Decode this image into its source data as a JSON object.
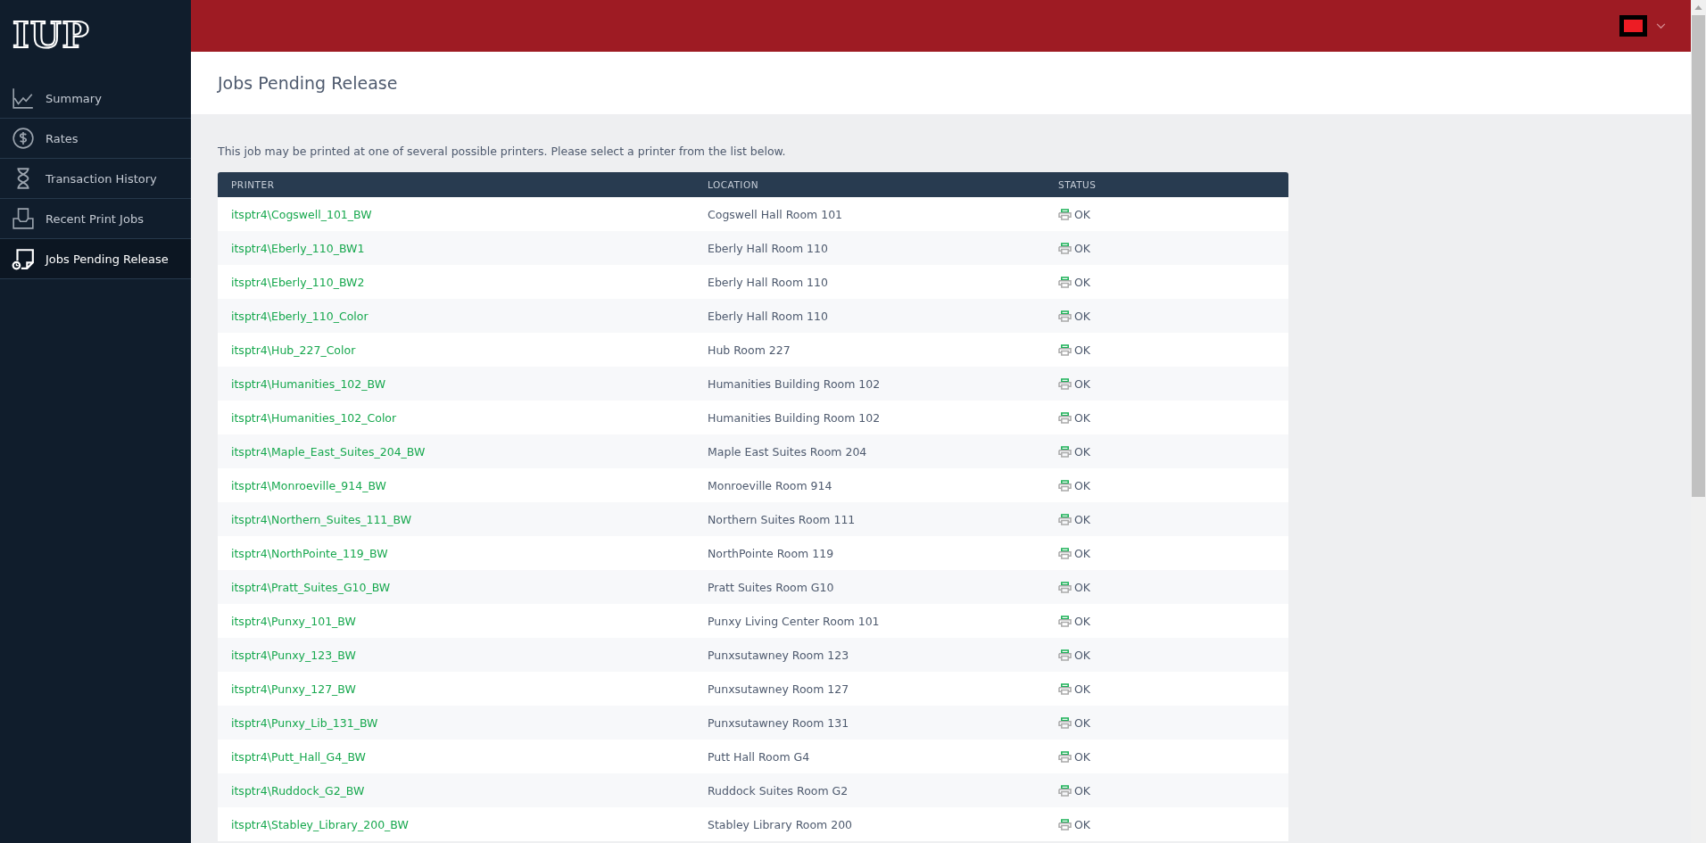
{
  "brand": "IUP",
  "sidebar": {
    "items": [
      {
        "label": "Summary",
        "selected": false
      },
      {
        "label": "Rates",
        "selected": false
      },
      {
        "label": "Transaction History",
        "selected": false
      },
      {
        "label": "Recent Print Jobs",
        "selected": false
      },
      {
        "label": "Jobs Pending Release",
        "selected": true
      }
    ]
  },
  "page_title": "Jobs Pending Release",
  "intro": "This job may be printed at one of several possible printers. Please select a printer from the list below.",
  "table": {
    "columns": [
      "PRINTER",
      "LOCATION",
      "STATUS"
    ],
    "rows": [
      {
        "printer": "itsptr4\\Cogswell_101_BW",
        "location": "Cogswell Hall Room 101",
        "status": "OK"
      },
      {
        "printer": "itsptr4\\Eberly_110_BW1",
        "location": "Eberly Hall Room 110",
        "status": "OK"
      },
      {
        "printer": "itsptr4\\Eberly_110_BW2",
        "location": "Eberly Hall Room 110",
        "status": "OK"
      },
      {
        "printer": "itsptr4\\Eberly_110_Color",
        "location": "Eberly Hall Room 110",
        "status": "OK"
      },
      {
        "printer": "itsptr4\\Hub_227_Color",
        "location": "Hub Room 227",
        "status": "OK"
      },
      {
        "printer": "itsptr4\\Humanities_102_BW",
        "location": "Humanities Building Room 102",
        "status": "OK"
      },
      {
        "printer": "itsptr4\\Humanities_102_Color",
        "location": "Humanities Building Room 102",
        "status": "OK"
      },
      {
        "printer": "itsptr4\\Maple_East_Suites_204_BW",
        "location": "Maple East Suites Room 204",
        "status": "OK"
      },
      {
        "printer": "itsptr4\\Monroeville_914_BW",
        "location": "Monroeville Room 914",
        "status": "OK"
      },
      {
        "printer": "itsptr4\\Northern_Suites_111_BW",
        "location": "Northern Suites Room 111",
        "status": "OK"
      },
      {
        "printer": "itsptr4\\NorthPointe_119_BW",
        "location": "NorthPointe Room 119",
        "status": "OK"
      },
      {
        "printer": "itsptr4\\Pratt_Suites_G10_BW",
        "location": "Pratt Suites Room G10",
        "status": "OK"
      },
      {
        "printer": "itsptr4\\Punxy_101_BW",
        "location": "Punxy Living Center Room 101",
        "status": "OK"
      },
      {
        "printer": "itsptr4\\Punxy_123_BW",
        "location": "Punxsutawney Room 123",
        "status": "OK"
      },
      {
        "printer": "itsptr4\\Punxy_127_BW",
        "location": "Punxsutawney Room 127",
        "status": "OK"
      },
      {
        "printer": "itsptr4\\Punxy_Lib_131_BW",
        "location": "Punxsutawney Room 131",
        "status": "OK"
      },
      {
        "printer": "itsptr4\\Putt_Hall_G4_BW",
        "location": "Putt Hall Room G4",
        "status": "OK"
      },
      {
        "printer": "itsptr4\\Ruddock_G2_BW",
        "location": "Ruddock Suites Room G2",
        "status": "OK"
      },
      {
        "printer": "itsptr4\\Stabley_Library_200_BW",
        "location": "Stabley Library Room 200",
        "status": "OK"
      }
    ]
  }
}
